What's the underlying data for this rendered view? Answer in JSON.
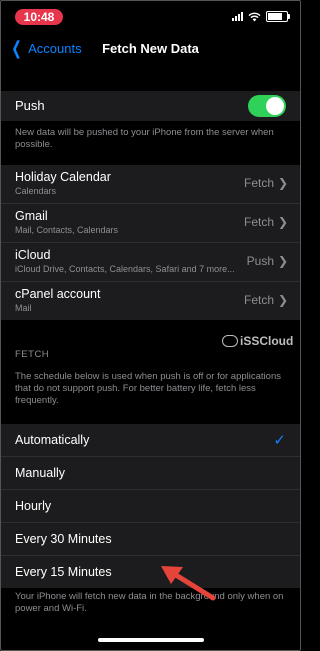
{
  "status": {
    "time": "10:48"
  },
  "nav": {
    "back_label": "Accounts",
    "title": "Fetch New Data"
  },
  "push": {
    "label": "Push",
    "enabled": true,
    "note": "New data will be pushed to your iPhone from the server when possible."
  },
  "accounts": [
    {
      "name": "Holiday Calendar",
      "sub": "Calendars",
      "value": "Fetch"
    },
    {
      "name": "Gmail",
      "sub": "Mail, Contacts, Calendars",
      "value": "Fetch"
    },
    {
      "name": "iCloud",
      "sub": "iCloud Drive, Contacts, Calendars, Safari and 7 more...",
      "value": "Push"
    },
    {
      "name": "cPanel account",
      "sub": "Mail",
      "value": "Fetch"
    }
  ],
  "watermark": "iSSCloud",
  "fetch": {
    "header": "FETCH",
    "note": "The schedule below is used when push is off or for applications that do not support push. For better battery life, fetch less frequently.",
    "options": [
      "Automatically",
      "Manually",
      "Hourly",
      "Every 30 Minutes",
      "Every 15 Minutes"
    ],
    "selected": "Automatically",
    "footer": "Your iPhone will fetch new data in the background only when on power and Wi-Fi."
  },
  "colors": {
    "accent": "#0a84ff",
    "toggle_on": "#30d158",
    "arrow": "#e5443a",
    "time_pill": "#e7354c"
  }
}
